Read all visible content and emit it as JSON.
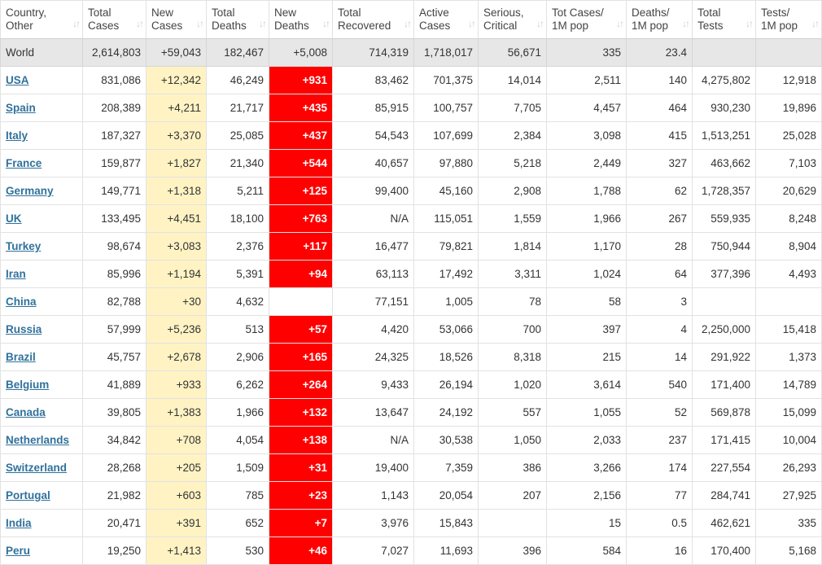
{
  "columns": [
    {
      "l1": "Country,",
      "l2": "Other"
    },
    {
      "l1": "Total",
      "l2": "Cases"
    },
    {
      "l1": "New",
      "l2": "Cases"
    },
    {
      "l1": "Total",
      "l2": "Deaths"
    },
    {
      "l1": "New",
      "l2": "Deaths"
    },
    {
      "l1": "Total",
      "l2": "Recovered"
    },
    {
      "l1": "Active",
      "l2": "Cases"
    },
    {
      "l1": "Serious,",
      "l2": "Critical"
    },
    {
      "l1": "Tot Cases/",
      "l2": "1M pop"
    },
    {
      "l1": "Deaths/",
      "l2": "1M pop"
    },
    {
      "l1": "Total",
      "l2": "Tests"
    },
    {
      "l1": "Tests/",
      "l2": "1M pop"
    }
  ],
  "sort_icon": "sort-arrows-icon",
  "world": [
    "World",
    "2,614,803",
    "+59,043",
    "182,467",
    "+5,008",
    "714,319",
    "1,718,017",
    "56,671",
    "335",
    "23.4",
    "",
    ""
  ],
  "rows": [
    [
      "USA",
      "831,086",
      "+12,342",
      "46,249",
      "+931",
      "83,462",
      "701,375",
      "14,014",
      "2,511",
      "140",
      "4,275,802",
      "12,918"
    ],
    [
      "Spain",
      "208,389",
      "+4,211",
      "21,717",
      "+435",
      "85,915",
      "100,757",
      "7,705",
      "4,457",
      "464",
      "930,230",
      "19,896"
    ],
    [
      "Italy",
      "187,327",
      "+3,370",
      "25,085",
      "+437",
      "54,543",
      "107,699",
      "2,384",
      "3,098",
      "415",
      "1,513,251",
      "25,028"
    ],
    [
      "France",
      "159,877",
      "+1,827",
      "21,340",
      "+544",
      "40,657",
      "97,880",
      "5,218",
      "2,449",
      "327",
      "463,662",
      "7,103"
    ],
    [
      "Germany",
      "149,771",
      "+1,318",
      "5,211",
      "+125",
      "99,400",
      "45,160",
      "2,908",
      "1,788",
      "62",
      "1,728,357",
      "20,629"
    ],
    [
      "UK",
      "133,495",
      "+4,451",
      "18,100",
      "+763",
      "N/A",
      "115,051",
      "1,559",
      "1,966",
      "267",
      "559,935",
      "8,248"
    ],
    [
      "Turkey",
      "98,674",
      "+3,083",
      "2,376",
      "+117",
      "16,477",
      "79,821",
      "1,814",
      "1,170",
      "28",
      "750,944",
      "8,904"
    ],
    [
      "Iran",
      "85,996",
      "+1,194",
      "5,391",
      "+94",
      "63,113",
      "17,492",
      "3,311",
      "1,024",
      "64",
      "377,396",
      "4,493"
    ],
    [
      "China",
      "82,788",
      "+30",
      "4,632",
      "",
      "77,151",
      "1,005",
      "78",
      "58",
      "3",
      "",
      ""
    ],
    [
      "Russia",
      "57,999",
      "+5,236",
      "513",
      "+57",
      "4,420",
      "53,066",
      "700",
      "397",
      "4",
      "2,250,000",
      "15,418"
    ],
    [
      "Brazil",
      "45,757",
      "+2,678",
      "2,906",
      "+165",
      "24,325",
      "18,526",
      "8,318",
      "215",
      "14",
      "291,922",
      "1,373"
    ],
    [
      "Belgium",
      "41,889",
      "+933",
      "6,262",
      "+264",
      "9,433",
      "26,194",
      "1,020",
      "3,614",
      "540",
      "171,400",
      "14,789"
    ],
    [
      "Canada",
      "39,805",
      "+1,383",
      "1,966",
      "+132",
      "13,647",
      "24,192",
      "557",
      "1,055",
      "52",
      "569,878",
      "15,099"
    ],
    [
      "Netherlands",
      "34,842",
      "+708",
      "4,054",
      "+138",
      "N/A",
      "30,538",
      "1,050",
      "2,033",
      "237",
      "171,415",
      "10,004"
    ],
    [
      "Switzerland",
      "28,268",
      "+205",
      "1,509",
      "+31",
      "19,400",
      "7,359",
      "386",
      "3,266",
      "174",
      "227,554",
      "26,293"
    ],
    [
      "Portugal",
      "21,982",
      "+603",
      "785",
      "+23",
      "1,143",
      "20,054",
      "207",
      "2,156",
      "77",
      "284,741",
      "27,925"
    ],
    [
      "India",
      "20,471",
      "+391",
      "652",
      "+7",
      "3,976",
      "15,843",
      "",
      "15",
      "0.5",
      "462,621",
      "335"
    ],
    [
      "Peru",
      "19,250",
      "+1,413",
      "530",
      "+46",
      "7,027",
      "11,693",
      "396",
      "584",
      "16",
      "170,400",
      "5,168"
    ]
  ]
}
